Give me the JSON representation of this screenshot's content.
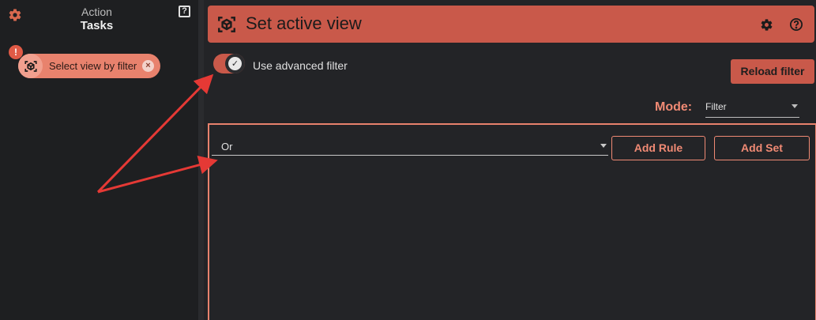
{
  "sidebar": {
    "title_sub": "Action",
    "title_main": "Tasks",
    "help_label": "?",
    "task": {
      "label": "Select view by filter",
      "warning": "!",
      "close": "×"
    }
  },
  "header": {
    "title": "Set active view"
  },
  "filter_toggle": {
    "label": "Use advanced filter",
    "enabled": true
  },
  "reload_button": {
    "label": "Reload filter"
  },
  "mode": {
    "label": "Mode:",
    "value": "Filter"
  },
  "rule_group": {
    "combinator": "Or",
    "add_rule_label": "Add Rule",
    "add_set_label": "Add Set"
  },
  "colors": {
    "accent": "#c9594a",
    "accent_light": "#e8826d",
    "annotation_arrow": "#e53935",
    "background": "#232427"
  },
  "icons": {
    "settings": "gear-icon",
    "help": "help-icon",
    "view_filter": "cube-scan-icon"
  }
}
